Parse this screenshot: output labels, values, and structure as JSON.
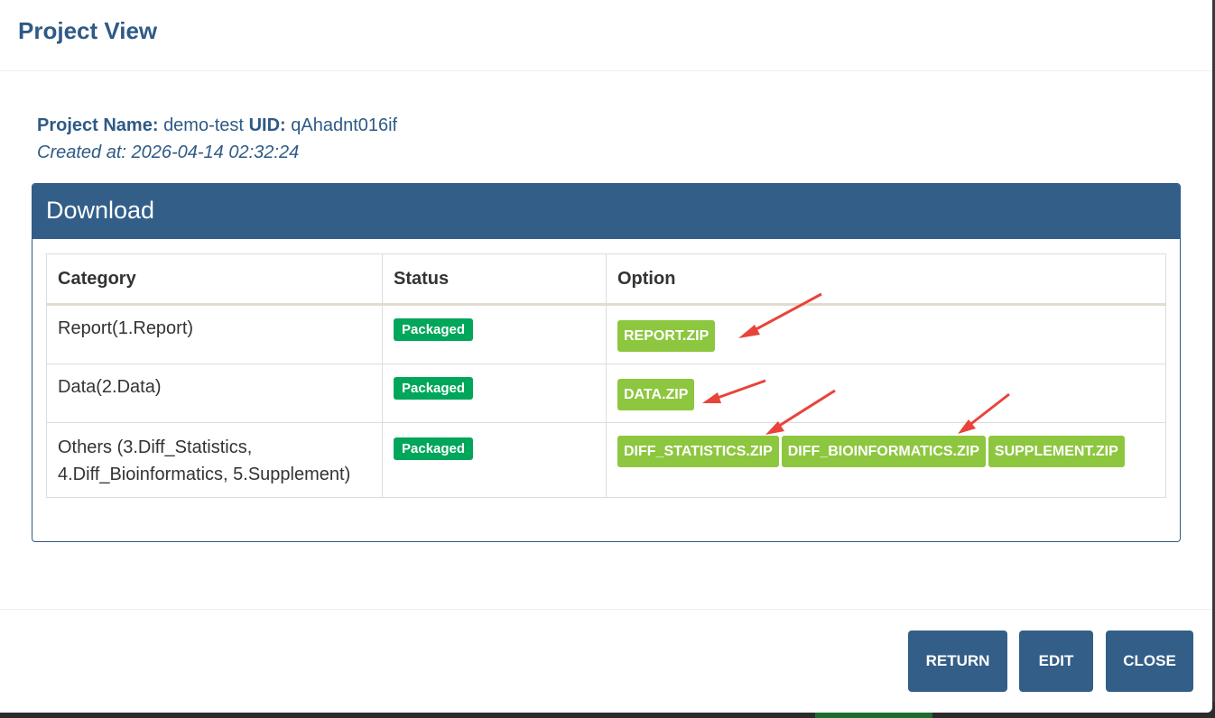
{
  "modal": {
    "title": "Project View"
  },
  "project": {
    "name_label": "Project Name:",
    "name_value": "demo-test",
    "uid_label": "UID:",
    "uid_value": "qAhadnt016if",
    "created_text": "Created at: 2026-04-14 02:32:24"
  },
  "download": {
    "heading": "Download",
    "columns": [
      "Category",
      "Status",
      "Option"
    ],
    "rows": [
      {
        "category": "Report(1.Report)",
        "status": "Packaged",
        "options": [
          "REPORT.ZIP"
        ]
      },
      {
        "category": "Data(2.Data)",
        "status": "Packaged",
        "options": [
          "DATA.ZIP"
        ]
      },
      {
        "category_line1": "Others (3.Diff_Statistics,",
        "category_line2": "4.Diff_Bioinformatics, 5.Supplement)",
        "status": "Packaged",
        "options": [
          "DIFF_STATISTICS.ZIP",
          "DIFF_BIOINFORMATICS.ZIP",
          "SUPPLEMENT.ZIP"
        ]
      }
    ]
  },
  "footer": {
    "return_label": "RETURN",
    "edit_label": "EDIT",
    "close_label": "CLOSE"
  },
  "colors": {
    "primary": "#335e88",
    "title_text": "#2e5a86",
    "status_badge": "#00a65a",
    "option_button": "#8dc63f",
    "annotation_arrow": "#e8443a"
  },
  "icons": {
    "annotation": "red-arrow-icon"
  }
}
